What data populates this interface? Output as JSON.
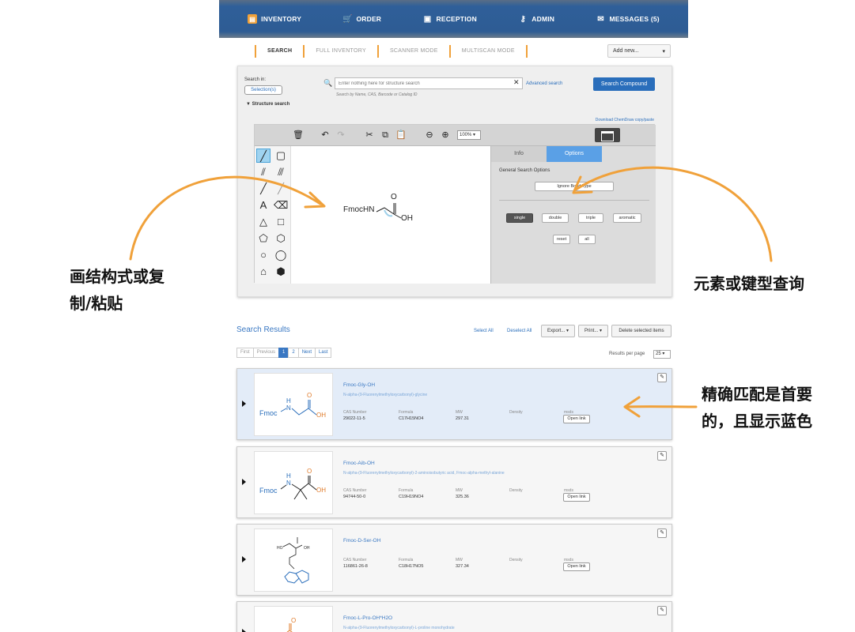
{
  "nav": {
    "inventory": "INVENTORY",
    "order": "ORDER",
    "reception": "RECEPTION",
    "admin": "ADMIN",
    "messages": "MESSAGES (5)"
  },
  "subtabs": [
    "SEARCH",
    "FULL INVENTORY",
    "SCANNER MODE",
    "MULTISCAN MODE"
  ],
  "add_new": "Add new...",
  "search": {
    "search_in_label": "Search in:",
    "selection_btn": "Selection(s)",
    "structure_toggle": "Structure search",
    "placeholder": "Enter nothing here for structure search",
    "hint": "Search by Name, CAS, Barcode or Catalog ID",
    "advanced": "Advanced search",
    "submit": "Search Compound",
    "download_link": "Download ChemDraw copy/paste"
  },
  "editor": {
    "zoom": "100%",
    "molecule_label_left": "FmocHN",
    "molecule_label_oh": "OH",
    "molecule_label_o": "O",
    "tabs": [
      "Info",
      "Options"
    ],
    "options_title": "General Search Options",
    "ignore_bond_type": "Ignore Bond Type",
    "bond_buttons": [
      "single",
      "double",
      "triple",
      "aromatic"
    ],
    "reset": "reset",
    "all": "all",
    "tool_text": "A"
  },
  "results": {
    "title": "Search Results",
    "select_all": "Select All",
    "deselect_all": "Deselect All",
    "export": "Export... ▾",
    "print": "Print... ▾",
    "delete_selected": "Delete selected items",
    "pager": [
      "First",
      "Previous",
      "1",
      "2",
      "Next",
      "Last"
    ],
    "per_page_label": "Results per page",
    "per_page_value": "25 ▾",
    "field_labels": {
      "cas": "CAS Number",
      "formula": "Formula",
      "mw": "MW",
      "density": "Density",
      "msds": "msds"
    },
    "open_link": "Open link",
    "thumb_labels": {
      "fmoc": "Fmoc",
      "h": "H",
      "n": "N",
      "o": "O",
      "oh": "OH",
      "ho": "HO"
    },
    "items": [
      {
        "name": "Fmoc-Gly-OH",
        "desc": "N-alpha-(9-Fluorenylmethyloxycarbonyl)-glycine",
        "cas": "29022-11-5",
        "formula": "C17H15NO4",
        "mw": "297.31"
      },
      {
        "name": "Fmoc-Aib-OH",
        "desc": "N-alpha-(9-Fluorenylmethyloxycarbonyl)-2-aminoisobutyric acid, Fmoc-alpha-methyl-alanine",
        "cas": "94744-50-0",
        "formula": "C19H19NO4",
        "mw": "325.36"
      },
      {
        "name": "Fmoc-D-Ser-OH",
        "desc": "",
        "cas": "116861-26-8",
        "formula": "C18H17NO5",
        "mw": "327.34"
      },
      {
        "name": "Fmoc-L-Pro-OH*H2O",
        "desc": "N-alpha-(9-Fluorenylmethyloxycarbonyl)-L-proline monohydrate",
        "cas": "",
        "formula": "",
        "mw": ""
      }
    ]
  },
  "annotations": {
    "left_line1": "画结构式或复",
    "left_line2": "制/粘贴",
    "right": "元素或键型查询",
    "match_line1": "精确匹配是首要",
    "match_line2": "的，且显示蓝色"
  },
  "colors": {
    "nav_blue": "#2e5c94",
    "accent_orange": "#f0a13a",
    "link_blue": "#2a6ebb",
    "highlight_row": "#e3ecf8",
    "options_tab": "#5aa0e6"
  }
}
